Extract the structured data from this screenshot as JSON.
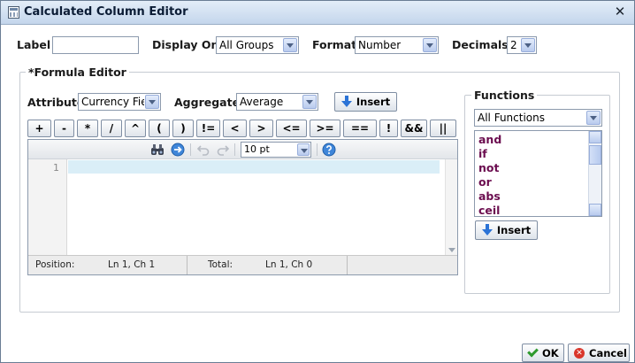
{
  "window": {
    "title": "Calculated Column Editor",
    "close_glyph": "✕"
  },
  "top_row": {
    "label": {
      "label": "Label",
      "value": ""
    },
    "display_on": {
      "label": "Display On",
      "value": "All Groups"
    },
    "format": {
      "label": "Format",
      "value": "Number"
    },
    "decimals": {
      "label": "Decimals",
      "value": "2"
    }
  },
  "formula_editor": {
    "legend": "*Formula Editor",
    "attribute": {
      "label": "Attribute",
      "value": "Currency Fie"
    },
    "aggregate": {
      "label": "Aggregate",
      "value": "Average"
    },
    "insert_label": "Insert",
    "operators": [
      "+",
      "-",
      "*",
      "/",
      "^",
      "(",
      ")",
      "!=",
      "<",
      ">",
      "<=",
      ">=",
      "==",
      "!",
      "&&",
      "||"
    ],
    "font_size": "10 pt",
    "line_number": "1",
    "status": {
      "position_label": "Position:",
      "position_value": "Ln 1, Ch 1",
      "total_label": "Total:",
      "total_value": "Ln 1, Ch 0"
    },
    "icons": [
      "binoculars-icon",
      "goto-icon",
      "undo-icon",
      "redo-icon",
      "help-icon"
    ]
  },
  "functions": {
    "legend": "Functions",
    "category": "All Functions",
    "items": [
      "and",
      "if",
      "not",
      "or",
      "abs",
      "ceil"
    ],
    "insert_label": "Insert"
  },
  "footer": {
    "ok_label": "OK",
    "cancel_label": "Cancel"
  },
  "colors": {
    "accent": "#2b73d6",
    "function_text": "#6b0d4f",
    "active_line": "#daeef7"
  }
}
